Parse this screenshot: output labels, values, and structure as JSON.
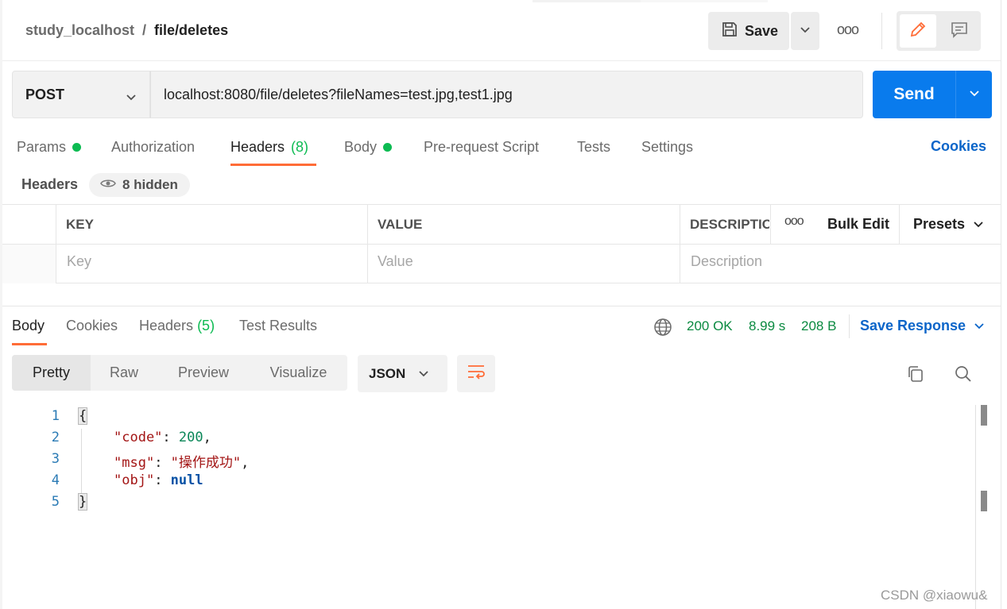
{
  "header": {
    "workspace": "study_localhost",
    "separator": "/",
    "request_name": "file/deletes",
    "save_label": "Save",
    "more_label": "ooo"
  },
  "request": {
    "method": "POST",
    "url": "localhost:8080/file/deletes?fileNames=test.jpg,test1.jpg",
    "send_label": "Send"
  },
  "tabs": {
    "params": "Params",
    "authorization": "Authorization",
    "headers": "Headers",
    "headers_count": "(8)",
    "body": "Body",
    "prerequest": "Pre-request Script",
    "tests": "Tests",
    "settings": "Settings",
    "cookies": "Cookies"
  },
  "headers_section": {
    "title": "Headers",
    "hidden": "8 hidden"
  },
  "table": {
    "col_key": "KEY",
    "col_value": "VALUE",
    "col_desc": "DESCRIPTION",
    "more_label": "ooo",
    "bulk_edit": "Bulk Edit",
    "presets": "Presets",
    "placeholder_key": "Key",
    "placeholder_value": "Value",
    "placeholder_desc": "Description"
  },
  "response": {
    "tabs": {
      "body": "Body",
      "cookies": "Cookies",
      "headers": "Headers",
      "headers_count": "(5)",
      "test_results": "Test Results"
    },
    "status": "200 OK",
    "time": "8.99 s",
    "size": "208 B",
    "save_response": "Save Response",
    "views": {
      "pretty": "Pretty",
      "raw": "Raw",
      "preview": "Preview",
      "visualize": "Visualize"
    },
    "format": "JSON",
    "code": {
      "line_numbers": [
        "1",
        "2",
        "3",
        "4",
        "5"
      ],
      "open_brace": "{",
      "close_brace": "}",
      "k_code": "\"code\"",
      "v_code": "200",
      "k_msg": "\"msg\"",
      "v_msg": "\"操作成功\"",
      "k_obj": "\"obj\"",
      "v_obj": "null",
      "colon": ": ",
      "comma": ","
    }
  },
  "watermark": "CSDN @xiaowu&"
}
